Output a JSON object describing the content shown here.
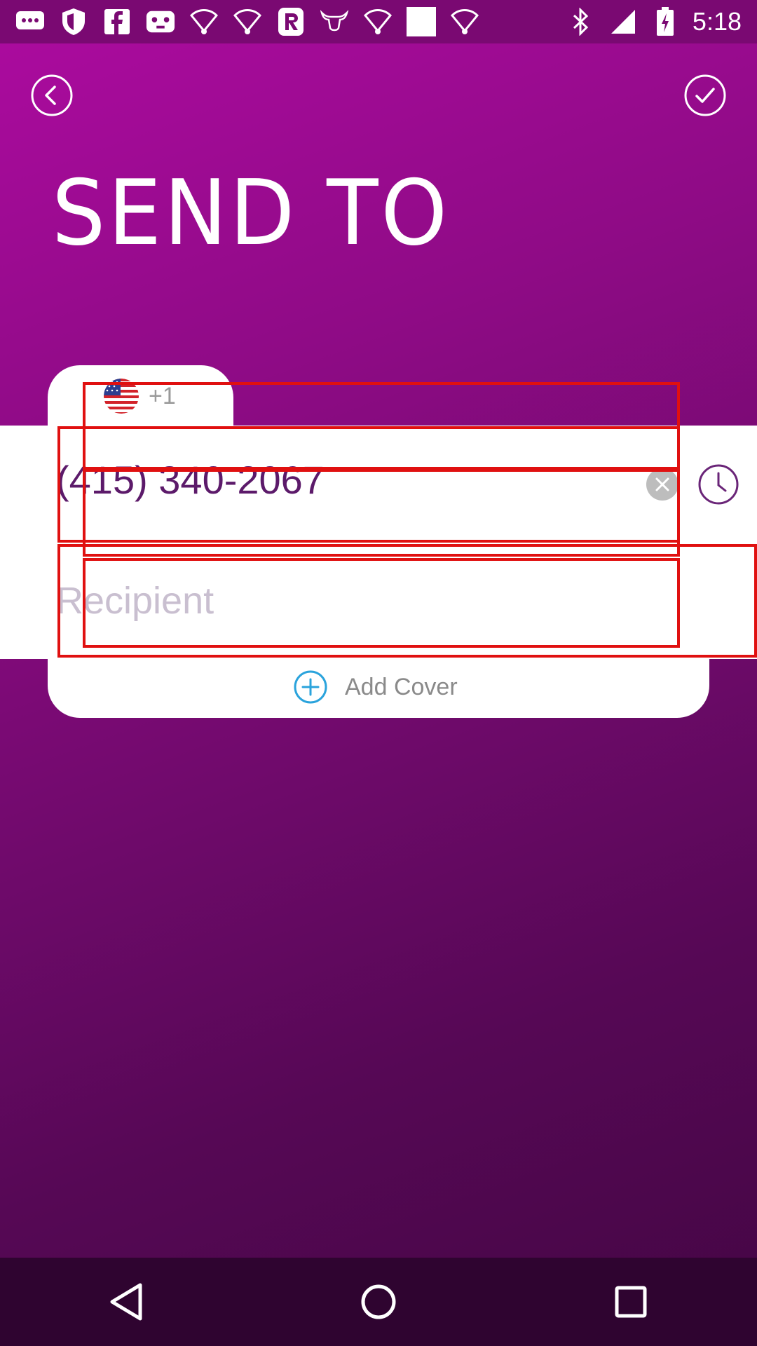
{
  "status_bar": {
    "time": "5:18",
    "icons_left": [
      "messages-icon",
      "shield-icon",
      "facebook-icon",
      "game-controller-icon",
      "wifi-icon",
      "wifi-icon",
      "r-app-icon",
      "bull-logo-icon",
      "wifi-icon",
      "square-icon",
      "wifi-icon"
    ],
    "icons_right": [
      "bluetooth-icon",
      "signal-icon",
      "battery-icon"
    ]
  },
  "header": {
    "title": "SEND TO"
  },
  "form": {
    "country_code": "+1",
    "phone_number": "(415) 340-2067",
    "recipient_placeholder": "Recipient",
    "add_cover_label": "Add Cover"
  },
  "colors": {
    "accent_purple": "#ad0ba0",
    "phone_text": "#5c1a6a",
    "add_cover_icon": "#2aa3dc",
    "highlight_red": "#e01010"
  }
}
